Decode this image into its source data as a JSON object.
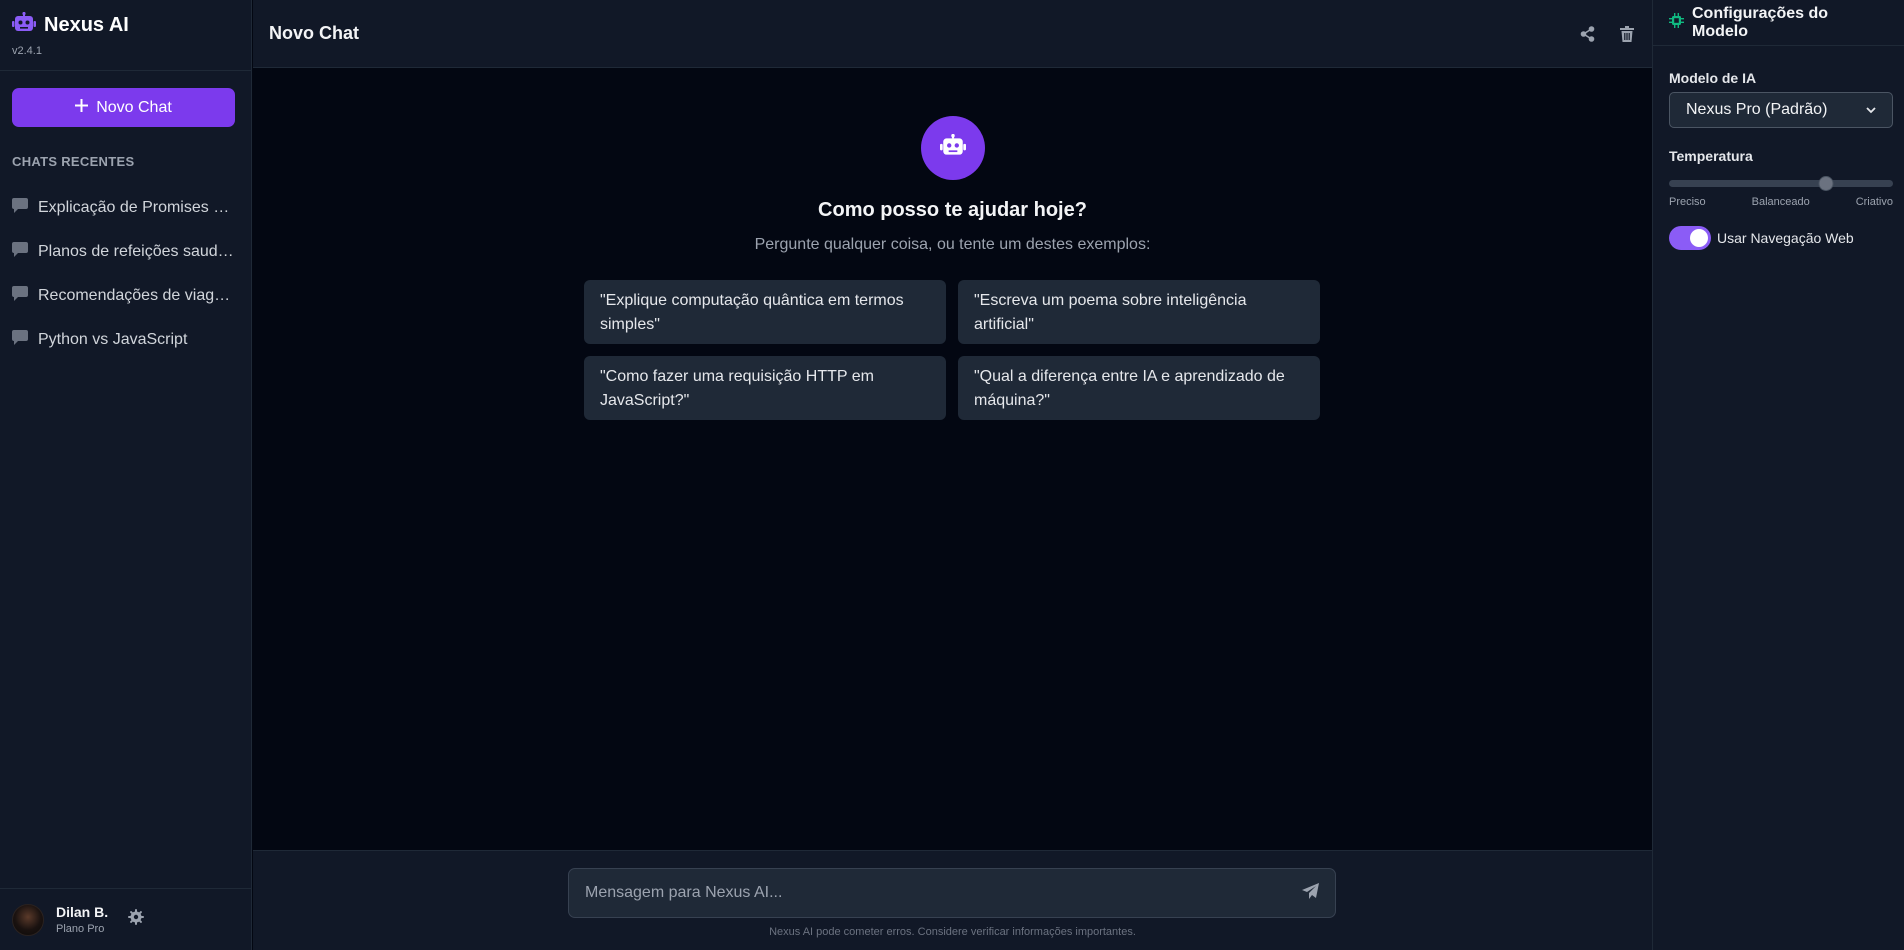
{
  "app": {
    "name": "Nexus AI",
    "version": "v2.4.1",
    "accent": "#7c3aed"
  },
  "sidebar": {
    "new_chat_label": "Novo Chat",
    "section_title": "CHATS RECENTES",
    "chats": [
      {
        "label": "Explicação de Promises JavaScript"
      },
      {
        "label": "Planos de refeições saudáveis"
      },
      {
        "label": "Recomendações de viagem"
      },
      {
        "label": "Python vs JavaScript"
      }
    ],
    "user": {
      "name": "Dilan B.",
      "plan": "Plano Pro"
    }
  },
  "main": {
    "title": "Novo Chat",
    "welcome_title": "Como posso te ajudar hoje?",
    "welcome_subtitle": "Pergunte qualquer coisa, ou tente um destes exemplos:",
    "examples": [
      {
        "text": "\"Explique computação quântica em termos simples\""
      },
      {
        "text": "\"Escreva um poema sobre inteligência artificial\""
      },
      {
        "text": "\"Como fazer uma requisição HTTP em JavaScript?\""
      },
      {
        "text": "\"Qual a diferença entre IA e aprendizado de máquina?\""
      }
    ],
    "composer": {
      "placeholder": "Mensagem para Nexus AI...",
      "value": ""
    },
    "disclaimer": "Nexus AI pode cometer erros. Considere verificar informações importantes."
  },
  "settings": {
    "title": "Configurações do Modelo",
    "model_label": "Modelo de IA",
    "model_value": "Nexus Pro (Padrão)",
    "temperature_label": "Temperatura",
    "temperature_value": 0.7,
    "temperature_ticks": [
      "Preciso",
      "Balanceado",
      "Criativo"
    ],
    "web_toggle_label": "Usar Navegação Web",
    "web_toggle_on": true
  },
  "icons": {
    "brand": "robot-icon",
    "new_chat": "plus-icon",
    "chat": "chat-bubble-icon",
    "share": "share-icon",
    "delete": "trash-icon",
    "send": "paper-plane-icon",
    "settings_header": "chip-icon",
    "user_settings": "gear-icon"
  }
}
